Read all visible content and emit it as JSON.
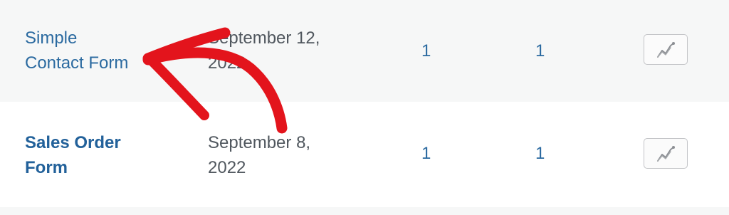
{
  "rows": [
    {
      "title_line1": "Simple",
      "title_line2": "Contact Form",
      "date_line1": "September 12,",
      "date_line2": "2022",
      "entries": "1",
      "views": "1",
      "chart_icon": "line-chart-icon"
    },
    {
      "title_line1": "Sales Order",
      "title_line2": "Form",
      "date_line1": "September 8,",
      "date_line2": "2022",
      "entries": "1",
      "views": "1",
      "chart_icon": "line-chart-icon"
    }
  ],
  "annotation": {
    "type": "hand-drawn-arrow",
    "color": "#e3141c"
  },
  "colors": {
    "link": "#2b6aa0",
    "text": "#50575e",
    "row_alt_bg": "#f6f7f7"
  }
}
